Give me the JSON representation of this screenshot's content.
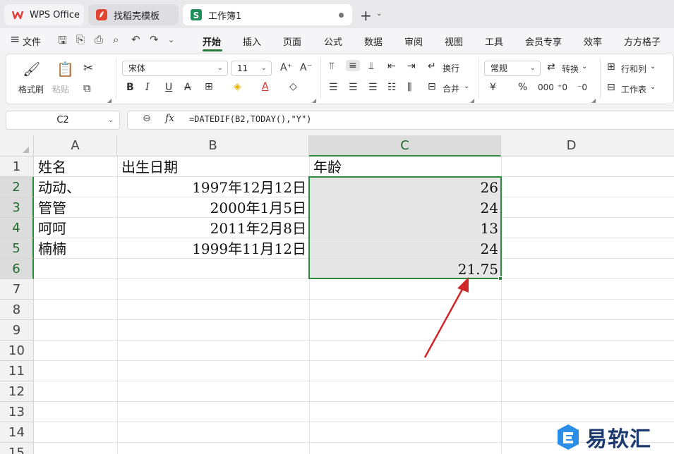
{
  "tabs": [
    {
      "label": "WPS Office"
    },
    {
      "label": "找稻壳模板"
    },
    {
      "label": "工作簿1"
    }
  ],
  "menu": {
    "file_label": "文件",
    "items": [
      "开始",
      "插入",
      "页面",
      "公式",
      "数据",
      "审阅",
      "视图",
      "工具",
      "会员专享",
      "效率",
      "方方格子"
    ],
    "active": "开始"
  },
  "ribbon": {
    "format_painter": "格式刷",
    "paste": "粘贴",
    "font_name": "宋体",
    "font_size": "11",
    "wrap": "换行",
    "merge": "合并",
    "number_format": "常规",
    "convert": "转换",
    "rowcol": "行和列",
    "worksheet": "工作表"
  },
  "formula_bar": {
    "name_box": "C2",
    "fx_label": "fx",
    "formula": "=DATEDIF(B2,TODAY(),\"Y\")"
  },
  "sheet": {
    "columns": [
      "A",
      "B",
      "C",
      "D"
    ],
    "rows": [
      "1",
      "2",
      "3",
      "4",
      "5",
      "6",
      "7",
      "8",
      "9",
      "10",
      "11",
      "12",
      "13",
      "14",
      "15"
    ],
    "header_row": [
      "姓名",
      "出生日期",
      "年龄"
    ],
    "data": [
      {
        "name": "动动、",
        "birth": "1997年12月12日",
        "age": "26"
      },
      {
        "name": "管管",
        "birth": "2000年1月5日",
        "age": "24"
      },
      {
        "name": "呵呵",
        "birth": "2011年2月8日",
        "age": "13"
      },
      {
        "name": "楠楠",
        "birth": "1999年11月12日",
        "age": "24"
      }
    ],
    "average": "21.75"
  },
  "watermark": {
    "text": "易软汇"
  },
  "colors": {
    "accent_green": "#2e8b3e",
    "arrow_red": "#d0262a",
    "wps_red": "#e53935",
    "sheet_green": "#1e8e5a"
  }
}
